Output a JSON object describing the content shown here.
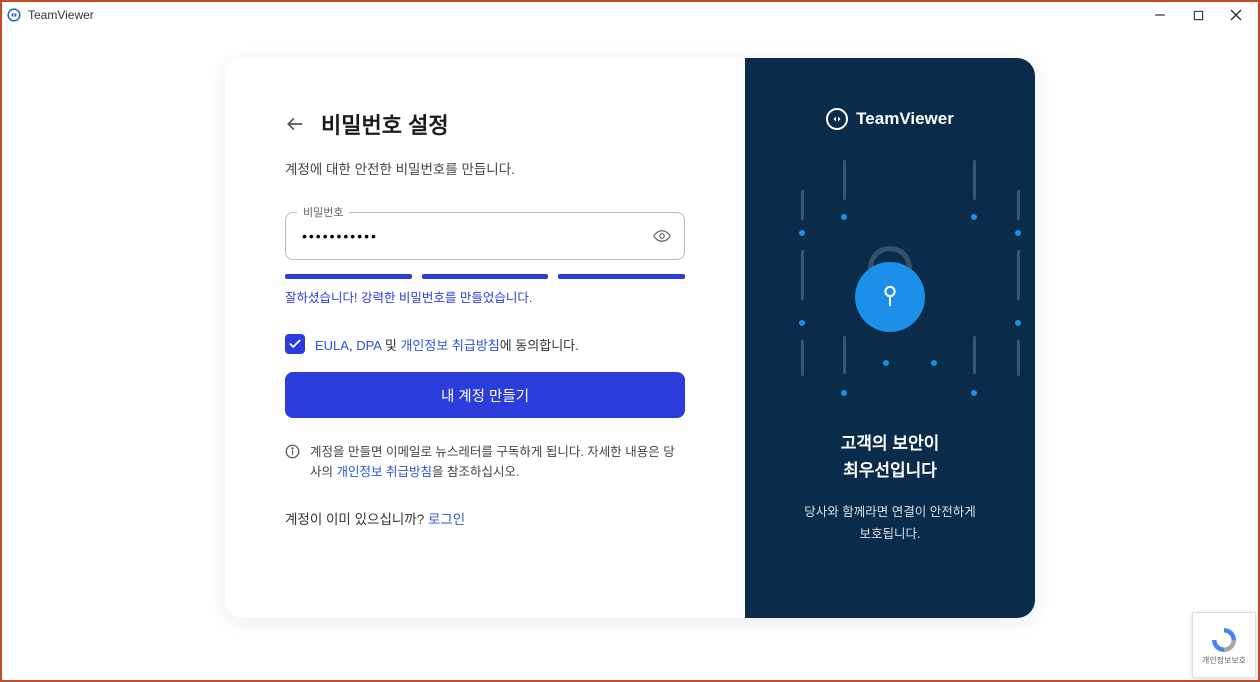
{
  "window": {
    "title": "TeamViewer"
  },
  "form": {
    "heading": "비밀번호 설정",
    "subtitle": "계정에 대한 안전한 비밀번호를 만듭니다.",
    "passwordLabel": "비밀번호",
    "passwordValue": "•••••••••••",
    "strengthMessage": "잘하셨습니다! 강력한 비밀번호를 만들었습니다.",
    "consent": {
      "prefix1": "EULA",
      "comma": ", ",
      "prefix2": "DPA",
      "mid": " 및 ",
      "link": "개인정보 취급방침",
      "suffix": "에 동의합니다."
    },
    "submitLabel": "내 계정 만들기",
    "newsletter": {
      "text1": "계정을 만들면 이메일로 뉴스레터를 구독하게 됩니다. 자세한 내용은 당사의 ",
      "link": "개인정보 취급방침",
      "text2": "을 참조하십시오."
    },
    "signin": {
      "question": "계정이 이미 있으십니까? ",
      "link": "로그인"
    }
  },
  "promo": {
    "brand": "TeamViewer",
    "titleLine1": "고객의 보안이",
    "titleLine2": "최우선입니다",
    "descLine1": "당사와 함께라면 연결이 안전하게",
    "descLine2": "보호됩니다."
  },
  "recaptcha": {
    "label": "개인정보보호"
  }
}
